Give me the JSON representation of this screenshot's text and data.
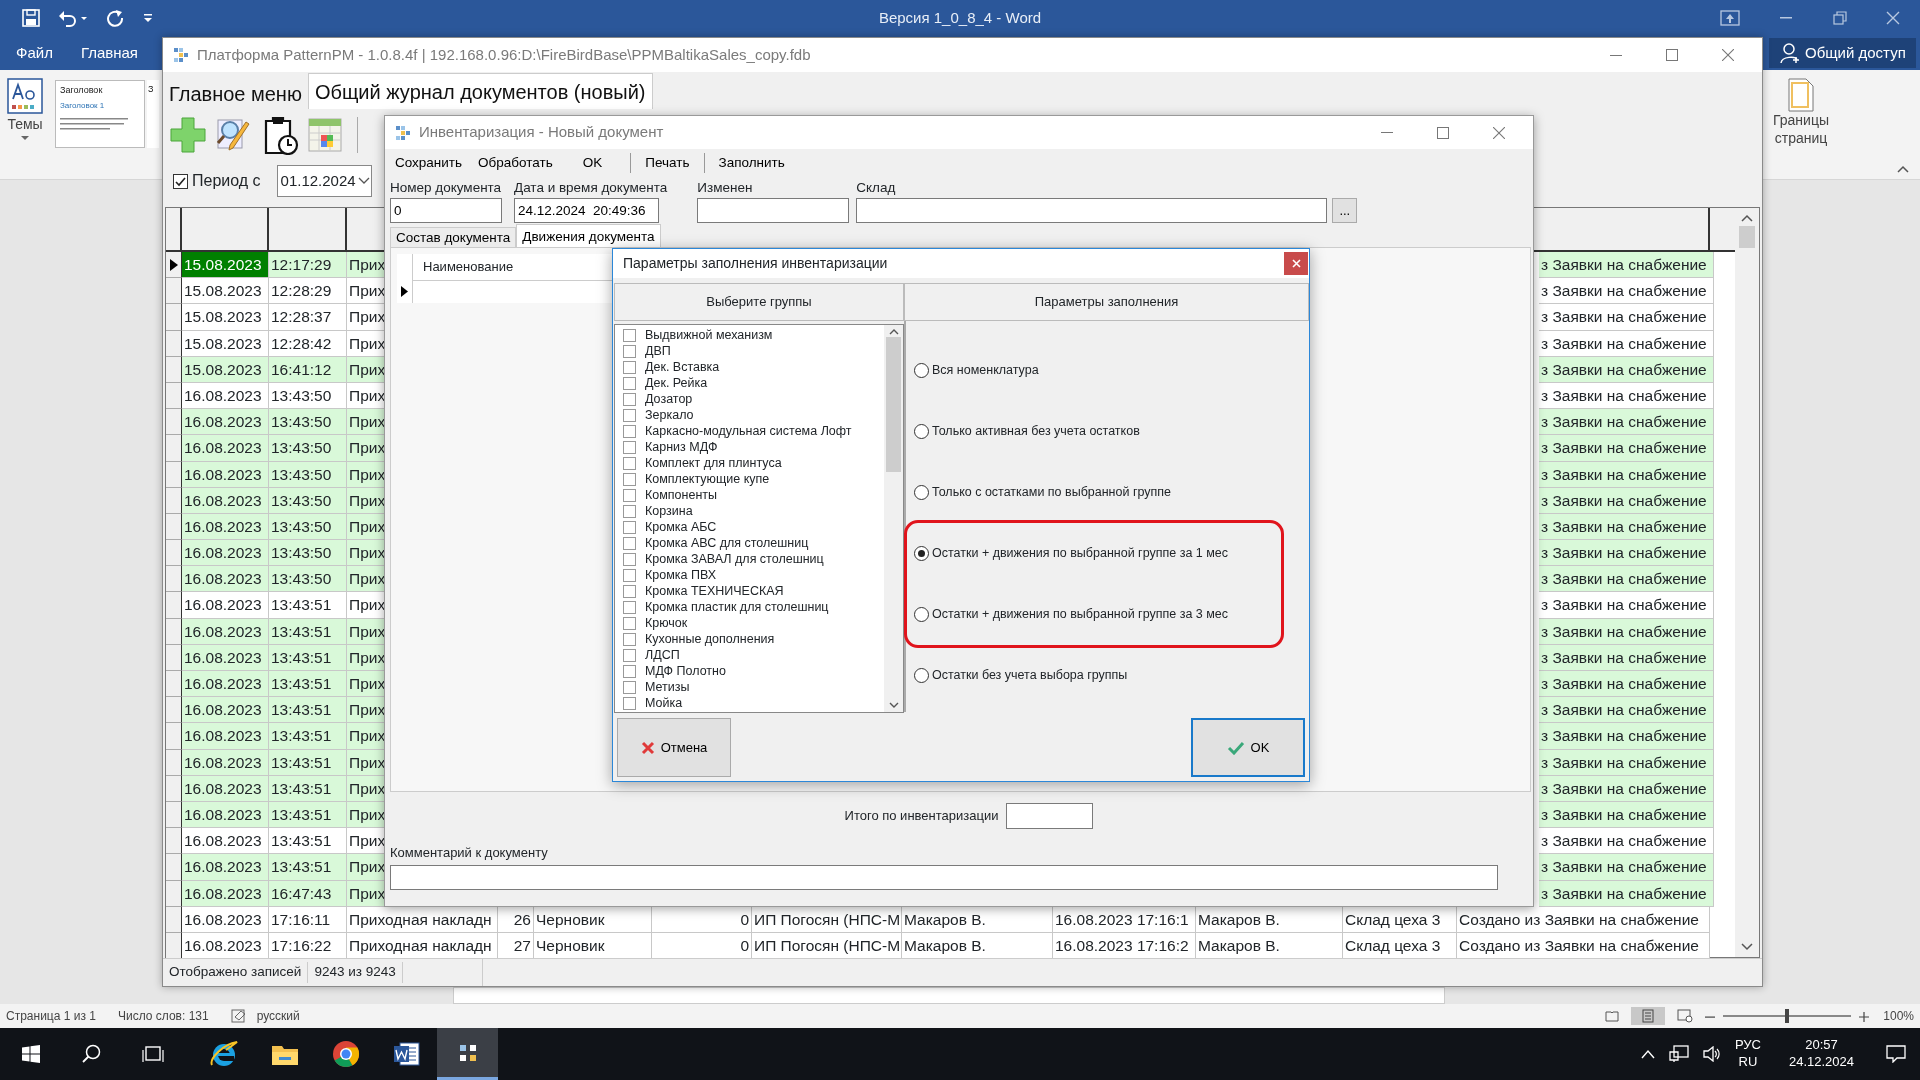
{
  "word": {
    "title": "Версия 1_0_8_4 - Word",
    "ribbon_tabs": [
      {
        "label": "Файл",
        "selected": false
      },
      {
        "label": "Главная",
        "selected": false
      }
    ],
    "share_button": "Общий доступ",
    "themes_button": "Темы",
    "style_gallery": [
      {
        "label": "Заголовок",
        "sublabel": "Заголовок 1"
      },
      {
        "label": "З"
      }
    ],
    "page_borders_button": "Границы страниц",
    "status_bar": {
      "page": "Страница 1 из 1",
      "words": "Число слов: 131",
      "language": "русский",
      "zoom": "100%",
      "level": 0.5
    }
  },
  "app": {
    "title": "Платформа PatternPM - 1.0.8.4f | 192.168.0.96:D:\\FireBirdBase\\PPMBaltikaSales_copy.fdb",
    "tabs": [
      {
        "label": "Главное меню",
        "selected": false
      },
      {
        "label": "Общий журнал документов (новый)",
        "selected": true
      }
    ],
    "period": {
      "label": "Период с",
      "checked": true,
      "date": "01.12.2024"
    },
    "rows": [
      {
        "kind": "partial",
        "selected": true,
        "color": "#d9f9d9",
        "date": "15.08.2023",
        "time": "12:17:29",
        "type": "Прих",
        "comment": "з Заявки на снабжение"
      },
      {
        "kind": "partial",
        "selected": false,
        "color": "#ffffff",
        "date": "15.08.2023",
        "time": "12:28:29",
        "type": "Прих",
        "comment": "з Заявки на снабжение"
      },
      {
        "kind": "partial",
        "selected": false,
        "color": "#ffffff",
        "date": "15.08.2023",
        "time": "12:28:37",
        "type": "Прих",
        "comment": "з Заявки на снабжение"
      },
      {
        "kind": "partial",
        "selected": false,
        "color": "#ffffff",
        "date": "15.08.2023",
        "time": "12:28:42",
        "type": "Прих",
        "comment": "з Заявки на снабжение"
      },
      {
        "kind": "partial",
        "selected": false,
        "color": "#d9f9d9",
        "date": "15.08.2023",
        "time": "16:41:12",
        "type": "Прих",
        "comment": "з Заявки на снабжение"
      },
      {
        "kind": "partial",
        "selected": false,
        "color": "#ffffff",
        "date": "16.08.2023",
        "time": "13:43:50",
        "type": "Прих",
        "comment": "з Заявки на снабжение"
      },
      {
        "kind": "partial",
        "selected": false,
        "color": "#d9f9d9",
        "date": "16.08.2023",
        "time": "13:43:50",
        "type": "Прих",
        "comment": "з Заявки на снабжение"
      },
      {
        "kind": "partial",
        "selected": false,
        "color": "#d9f9d9",
        "date": "16.08.2023",
        "time": "13:43:50",
        "type": "Прих",
        "comment": "з Заявки на снабжение"
      },
      {
        "kind": "partial",
        "selected": false,
        "color": "#d9f9d9",
        "date": "16.08.2023",
        "time": "13:43:50",
        "type": "Прих",
        "comment": "з Заявки на снабжение"
      },
      {
        "kind": "partial",
        "selected": false,
        "color": "#d9f9d9",
        "date": "16.08.2023",
        "time": "13:43:50",
        "type": "Прих",
        "comment": "з Заявки на снабжение"
      },
      {
        "kind": "partial",
        "selected": false,
        "color": "#d9f9d9",
        "date": "16.08.2023",
        "time": "13:43:50",
        "type": "Прих",
        "comment": "з Заявки на снабжение"
      },
      {
        "kind": "partial",
        "selected": false,
        "color": "#d9f9d9",
        "date": "16.08.2023",
        "time": "13:43:50",
        "type": "Прих",
        "comment": "з Заявки на снабжение"
      },
      {
        "kind": "partial",
        "selected": false,
        "color": "#d9f9d9",
        "date": "16.08.2023",
        "time": "13:43:50",
        "type": "Прих",
        "comment": "з Заявки на снабжение"
      },
      {
        "kind": "partial",
        "selected": false,
        "color": "#ffffff",
        "date": "16.08.2023",
        "time": "13:43:51",
        "type": "Прих",
        "comment": "з Заявки на снабжение"
      },
      {
        "kind": "partial",
        "selected": false,
        "color": "#d9f9d9",
        "date": "16.08.2023",
        "time": "13:43:51",
        "type": "Прих",
        "comment": "з Заявки на снабжение"
      },
      {
        "kind": "partial",
        "selected": false,
        "color": "#d9f9d9",
        "date": "16.08.2023",
        "time": "13:43:51",
        "type": "Прих",
        "comment": "з Заявки на снабжение"
      },
      {
        "kind": "partial",
        "selected": false,
        "color": "#d9f9d9",
        "date": "16.08.2023",
        "time": "13:43:51",
        "type": "Прих",
        "comment": "з Заявки на снабжение"
      },
      {
        "kind": "partial",
        "selected": false,
        "color": "#d9f9d9",
        "date": "16.08.2023",
        "time": "13:43:51",
        "type": "Прих",
        "comment": "з Заявки на снабжение"
      },
      {
        "kind": "partial",
        "selected": false,
        "color": "#d9f9d9",
        "date": "16.08.2023",
        "time": "13:43:51",
        "type": "Прих",
        "comment": "з Заявки на снабжение"
      },
      {
        "kind": "partial",
        "selected": false,
        "color": "#d9f9d9",
        "date": "16.08.2023",
        "time": "13:43:51",
        "type": "Прих",
        "comment": "з Заявки на снабжение"
      },
      {
        "kind": "partial",
        "selected": false,
        "color": "#d9f9d9",
        "date": "16.08.2023",
        "time": "13:43:51",
        "type": "Прих",
        "comment": "з Заявки на снабжение"
      },
      {
        "kind": "partial",
        "selected": false,
        "color": "#d9f9d9",
        "date": "16.08.2023",
        "time": "13:43:51",
        "type": "Прих",
        "comment": "з Заявки на снабжение"
      },
      {
        "kind": "partial",
        "selected": false,
        "color": "#ffffff",
        "date": "16.08.2023",
        "time": "13:43:51",
        "type": "Прих",
        "comment": "з Заявки на снабжение"
      },
      {
        "kind": "partial",
        "selected": false,
        "color": "#d9f9d9",
        "date": "16.08.2023",
        "time": "13:43:51",
        "type": "Прих",
        "comment": "з Заявки на снабжение"
      },
      {
        "kind": "partial",
        "selected": false,
        "color": "#d9f9d9",
        "date": "16.08.2023",
        "time": "16:47:43",
        "type": "Прих",
        "comment": "з Заявки на снабжение"
      },
      {
        "kind": "full",
        "selected": false,
        "color": "#ffffff",
        "cells": [
          "16.08.2023",
          "17:16:11",
          "Приходная накладн",
          "26",
          "Черновик",
          "0",
          "ИП Погосян (НПС-М",
          "Макаров В.",
          "16.08.2023 17:16:1",
          "Макаров В.",
          "Склад цеха 3",
          "Создано из Заявки на снабжение"
        ]
      },
      {
        "kind": "full",
        "selected": false,
        "color": "#ffffff",
        "cells": [
          "16.08.2023",
          "17:16:22",
          "Приходная накладн",
          "27",
          "Черновик",
          "0",
          "ИП Погосян (НПС-М",
          "Макаров В.",
          "16.08.2023 17:16:2",
          "Макаров В.",
          "Склад цеха 3",
          "Создано из Заявки на снабжение"
        ]
      }
    ],
    "status": {
      "label": "Отображено записей",
      "count": "9243 из 9243"
    }
  },
  "inventory": {
    "title": "Инвентаризация - Новый документ",
    "menu": [
      {
        "label": "Сохранить",
        "separator_before": false
      },
      {
        "label": "Обработать",
        "separator_before": false
      },
      {
        "label": "OK",
        "separator_before": false
      },
      {
        "label": "Печать",
        "separator_before": true
      },
      {
        "label": "Заполнить",
        "separator_before": true
      }
    ],
    "fields": [
      {
        "label": "Номер документа",
        "value": "0"
      },
      {
        "label": "Дата и время документа",
        "value": "24.12.2024  20:49:36"
      },
      {
        "label": "Изменен"
      },
      {
        "label": "Склад",
        "button": "..."
      }
    ],
    "tabs": [
      {
        "label": "Состав документа",
        "selected": false
      },
      {
        "label": "Движения документа",
        "selected": true
      }
    ],
    "grid_header": "Наименование",
    "total_label": "Итого по инвентаризации",
    "comment_label": "Комментарий к документу"
  },
  "dialog": {
    "title": "Параметры заполнения инвентаризации",
    "groups_header": "Выберите группы",
    "params_header": "Параметры заполнения",
    "groups": [
      {
        "label": "Выдвижной механизм",
        "checked": false
      },
      {
        "label": "ДВП",
        "checked": false
      },
      {
        "label": "Дек. Вставка",
        "checked": false
      },
      {
        "label": "Дек. Рейка",
        "checked": false
      },
      {
        "label": "Дозатор",
        "checked": false
      },
      {
        "label": "Зеркало",
        "checked": false
      },
      {
        "label": "Каркасно-модульная система Лофт",
        "checked": false
      },
      {
        "label": "Карниз МДФ",
        "checked": false
      },
      {
        "label": "Комплект для плинтуса",
        "checked": false
      },
      {
        "label": "Комплектующие купе",
        "checked": false
      },
      {
        "label": "Компоненты",
        "checked": false
      },
      {
        "label": "Корзина",
        "checked": false
      },
      {
        "label": "Кромка АБС",
        "checked": false
      },
      {
        "label": "Кромка АВС для столешниц",
        "checked": false
      },
      {
        "label": "Кромка ЗАВАЛ для столешниц",
        "checked": false
      },
      {
        "label": "Кромка ПВХ",
        "checked": false
      },
      {
        "label": "Кромка ТЕХНИЧЕСКАЯ",
        "checked": false
      },
      {
        "label": "Кромка пластик для столешниц",
        "checked": false
      },
      {
        "label": "Крючок",
        "checked": false
      },
      {
        "label": "Кухонные дополнения",
        "checked": false
      },
      {
        "label": "ЛДСП",
        "checked": false
      },
      {
        "label": "МДФ Полотно",
        "checked": false
      },
      {
        "label": "Метизы",
        "checked": false
      },
      {
        "label": "Мойка",
        "checked": false
      }
    ],
    "options": [
      {
        "label": "Вся номенклатура",
        "selected": false,
        "highlighted": false
      },
      {
        "label": "Только активная без учета остатков",
        "selected": false,
        "highlighted": false
      },
      {
        "label": "Только с остатками по выбранной группе",
        "selected": false,
        "highlighted": false
      },
      {
        "label": "Остатки + движения по выбранной группе за 1 мес",
        "selected": true,
        "highlighted": true
      },
      {
        "label": "Остатки + движения по выбранной группе за 3 мес",
        "selected": false,
        "highlighted": true
      },
      {
        "label": "Остатки без учета выбора группы",
        "selected": false,
        "highlighted": false
      }
    ],
    "buttons": [
      {
        "label": "Отмена",
        "kind": "cancel",
        "default": false
      },
      {
        "label": "OK",
        "kind": "ok",
        "default": true
      }
    ]
  },
  "taskbar": {
    "apps": [
      {
        "kind": "ie",
        "active": false
      },
      {
        "kind": "explorer",
        "active": false
      },
      {
        "kind": "chrome",
        "active": false
      },
      {
        "kind": "word",
        "active": false
      },
      {
        "kind": "app",
        "active": true
      }
    ],
    "lang": "РУС",
    "lang_sub": "RU",
    "time": "20:57",
    "date": "24.12.2024"
  }
}
